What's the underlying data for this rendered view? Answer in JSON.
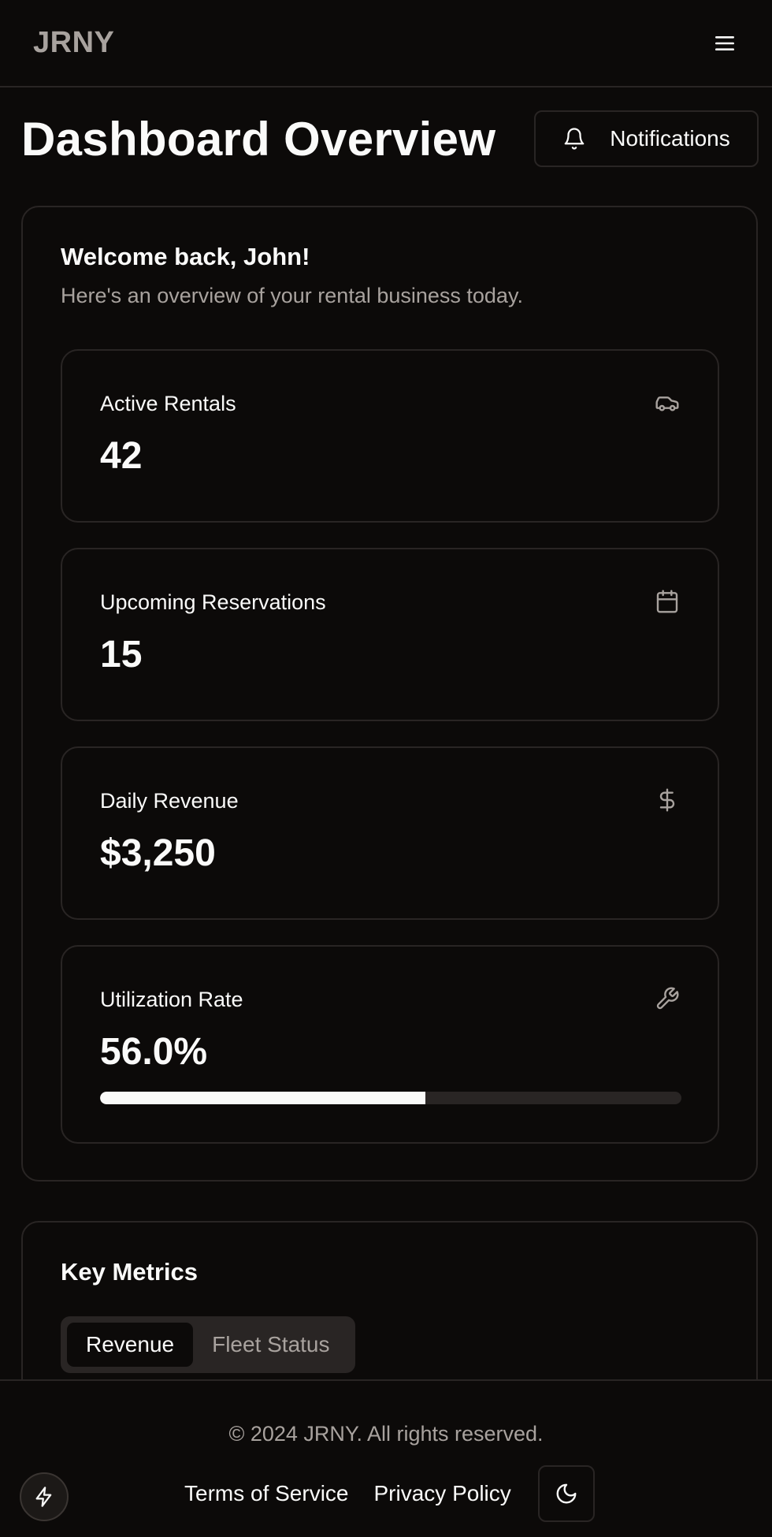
{
  "app": {
    "logo": "JRNY"
  },
  "header": {
    "title": "Dashboard Overview",
    "notifications_label": "Notifications"
  },
  "welcome": {
    "title": "Welcome back, John!",
    "subtitle": "Here's an overview of your rental business today."
  },
  "stats": [
    {
      "label": "Active Rentals",
      "value": "42",
      "icon": "car-icon"
    },
    {
      "label": "Upcoming Reservations",
      "value": "15",
      "icon": "calendar-icon"
    },
    {
      "label": "Daily Revenue",
      "value": "$3,250",
      "icon": "dollar-icon"
    },
    {
      "label": "Utilization Rate",
      "value": "56.0%",
      "icon": "wrench-icon",
      "progress": 0.56
    }
  ],
  "metrics": {
    "title": "Key Metrics",
    "tabs": [
      {
        "label": "Revenue",
        "active": true
      },
      {
        "label": "Fleet Status",
        "active": false
      }
    ]
  },
  "footer": {
    "copyright": "© 2024 JRNY. All rights reserved.",
    "links": [
      "Terms of Service",
      "Privacy Policy"
    ]
  },
  "colors": {
    "background": "#0c0a09",
    "border": "#292524",
    "text": "#fafaf9",
    "muted": "#a8a29e"
  }
}
